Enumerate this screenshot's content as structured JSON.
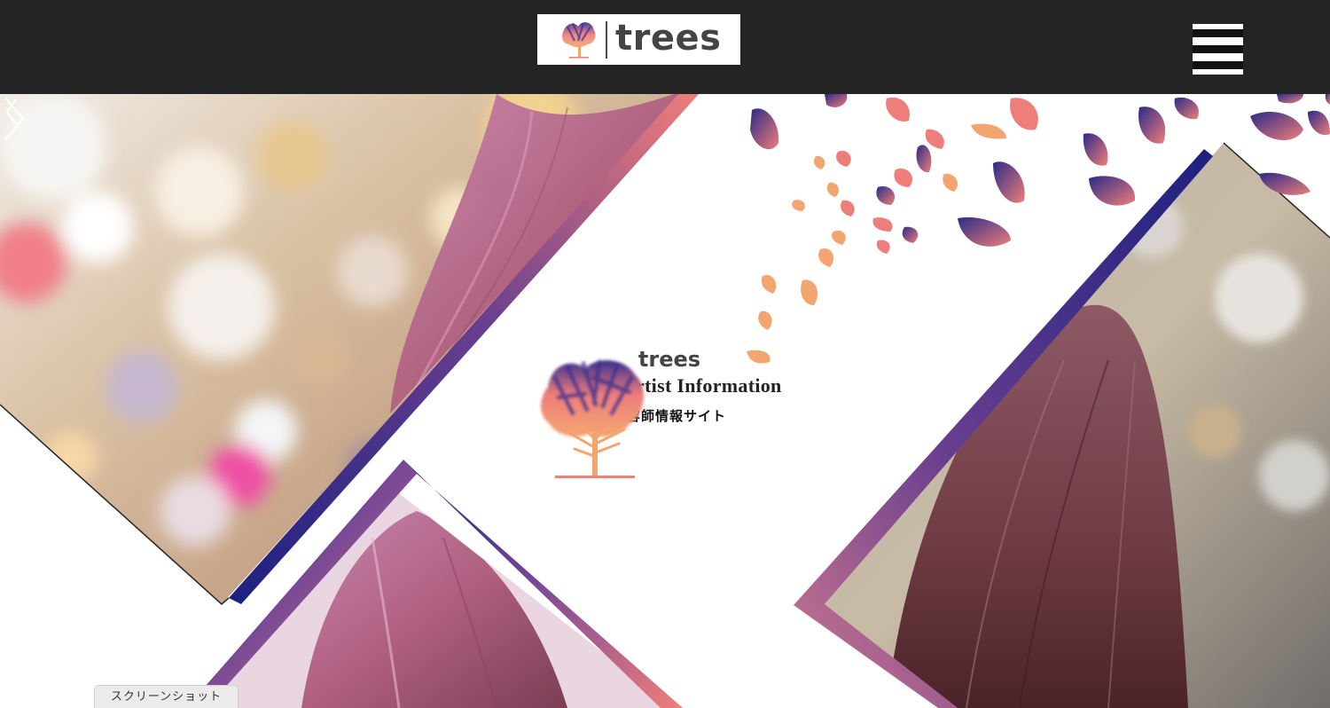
{
  "header": {
    "logo_text": "trees",
    "menu_icon": "hamburger-menu-icon"
  },
  "hero": {
    "brand_name": "trees",
    "tagline": "Beauty Artist Information",
    "subtitle": "美容師情報サイト",
    "prev_icon": "chevron-left-icon",
    "next_icon": "chevron-right-icon"
  },
  "footer_tab": {
    "label": "スクリーンショット"
  },
  "colors": {
    "header_bg": "#242424",
    "navy": "#1c2080",
    "purple": "#6a3f8f",
    "coral": "#ee7e7a",
    "orange": "#f3a570",
    "text_dark": "#222222"
  }
}
